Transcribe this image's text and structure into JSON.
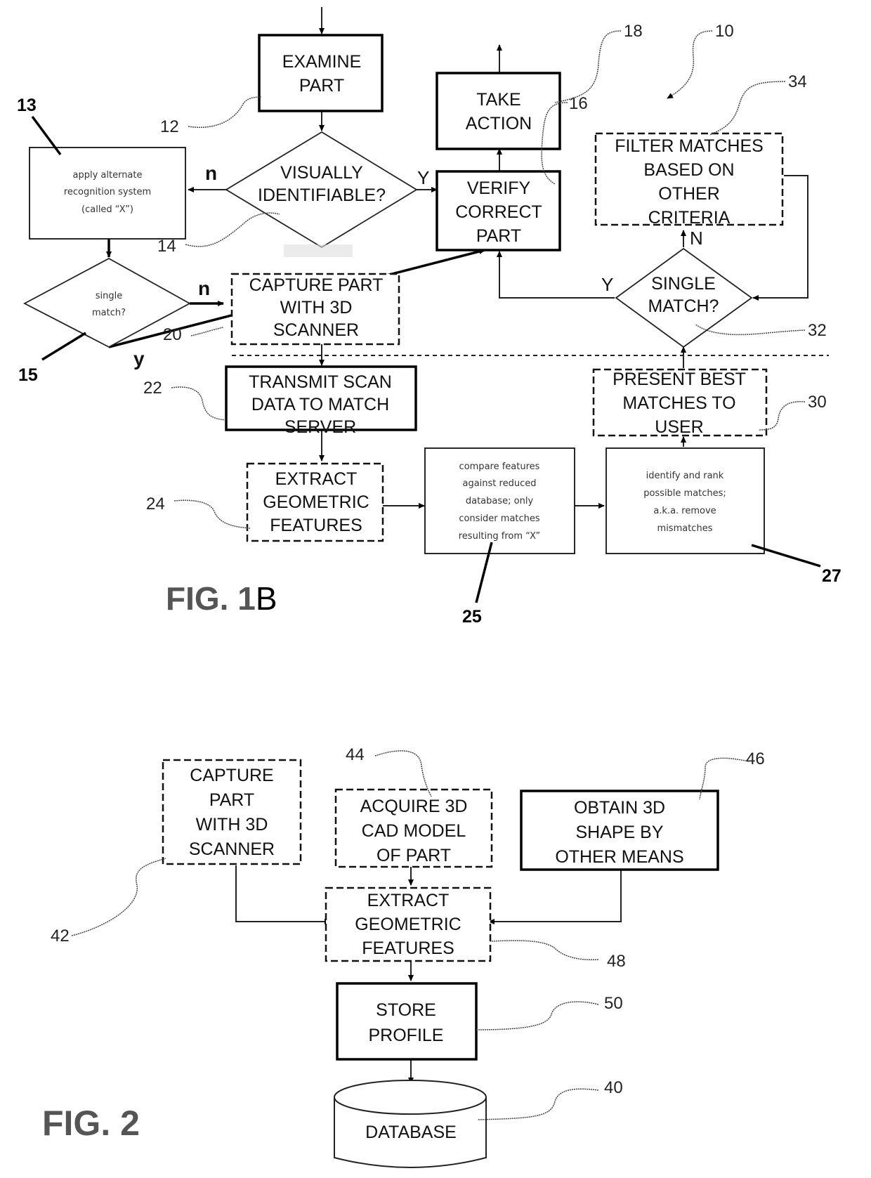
{
  "fig1b": {
    "title": "FIG. 1B",
    "title_prefix": "FIG. 1",
    "title_suffix": "B",
    "nodes": {
      "examine_part": {
        "ref": "12",
        "lines": [
          "EXAMINE",
          "PART"
        ]
      },
      "visually_identifiable": {
        "ref": "14",
        "lines": [
          "VISUALLY",
          "IDENTIFIABLE?"
        ]
      },
      "verify_correct_part": {
        "ref": "16",
        "lines": [
          "VERIFY",
          "CORRECT",
          "PART"
        ]
      },
      "take_action": {
        "ref": "18",
        "lines": [
          "TAKE",
          "ACTION"
        ]
      },
      "alternate_recognition": {
        "ref": "13",
        "lines": [
          "apply alternate",
          "recognition system",
          "(called “X”)"
        ]
      },
      "single_match_small": {
        "ref": "15",
        "lines": [
          "single",
          "match?"
        ]
      },
      "capture_part_scanner": {
        "ref": "20",
        "lines": [
          "CAPTURE PART",
          "WITH 3D",
          "SCANNER"
        ]
      },
      "transmit_scan": {
        "ref": "22",
        "lines": [
          "TRANSMIT SCAN",
          "DATA TO MATCH",
          "SERVER"
        ]
      },
      "extract_features": {
        "ref": "24",
        "lines": [
          "EXTRACT",
          "GEOMETRIC",
          "FEATURES"
        ]
      },
      "compare_features": {
        "ref": "25",
        "lines": [
          "compare features",
          "against reduced",
          "database; only",
          "consider matches",
          "resulting from “X”"
        ]
      },
      "identify_rank": {
        "ref": "27",
        "lines": [
          "identify and rank",
          "possible matches;",
          "a.k.a. remove",
          "mismatches"
        ]
      },
      "present_best": {
        "ref": "30",
        "lines": [
          "PRESENT BEST",
          "MATCHES TO",
          "USER"
        ]
      },
      "single_match": {
        "ref": "32",
        "lines": [
          "SINGLE",
          "MATCH?"
        ]
      },
      "filter_matches": {
        "ref": "34",
        "lines": [
          "FILTER MATCHES",
          "BASED ON",
          "OTHER",
          "CRITERIA"
        ]
      }
    },
    "system_ref": "10",
    "edge_labels": {
      "visually_no": "n",
      "visually_yes": "Y",
      "small_no": "n",
      "small_yes": "y",
      "single_yes": "Y",
      "single_no": "N"
    }
  },
  "fig2": {
    "title": "FIG. 2",
    "nodes": {
      "capture_part": {
        "ref": "42",
        "lines": [
          "CAPTURE",
          "PART",
          "WITH 3D",
          "SCANNER"
        ]
      },
      "acquire_cad": {
        "ref": "44",
        "lines": [
          "ACQUIRE 3D",
          "CAD MODEL",
          "OF PART"
        ]
      },
      "obtain_shape": {
        "ref": "46",
        "lines": [
          "OBTAIN 3D",
          "SHAPE BY",
          "OTHER MEANS"
        ]
      },
      "extract_features": {
        "ref": "48",
        "lines": [
          "EXTRACT",
          "GEOMETRIC",
          "FEATURES"
        ]
      },
      "store_profile": {
        "ref": "50",
        "lines": [
          "STORE",
          "PROFILE"
        ]
      },
      "database": {
        "ref": "40",
        "lines": [
          "DATABASE"
        ]
      }
    }
  }
}
